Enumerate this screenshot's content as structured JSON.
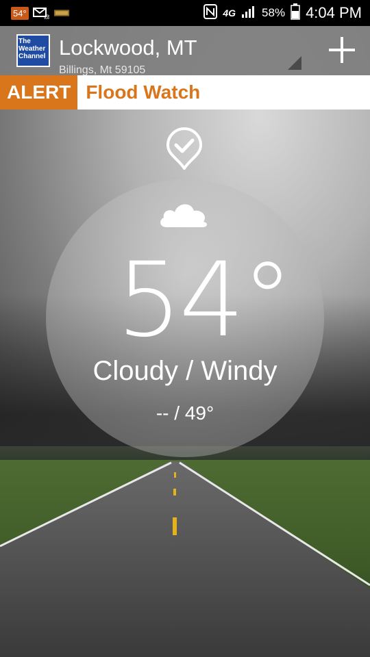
{
  "status_bar": {
    "notif_temp": "54°",
    "battery": "58%",
    "time": "4:04 PM",
    "network": "4G"
  },
  "header": {
    "logo_lines": [
      "The",
      "Weather",
      "Channel"
    ],
    "location": "Lockwood, MT",
    "sublocation": "Billings, Mt 59105"
  },
  "alert": {
    "badge": "ALERT",
    "text": "Flood Watch"
  },
  "weather": {
    "temperature": "54°",
    "condition": "Cloudy / Windy",
    "hi_lo": "-- / 49°",
    "icon": "cloud-icon"
  },
  "colors": {
    "alert_orange": "#d9761c",
    "logo_blue": "#1f4ba3"
  }
}
